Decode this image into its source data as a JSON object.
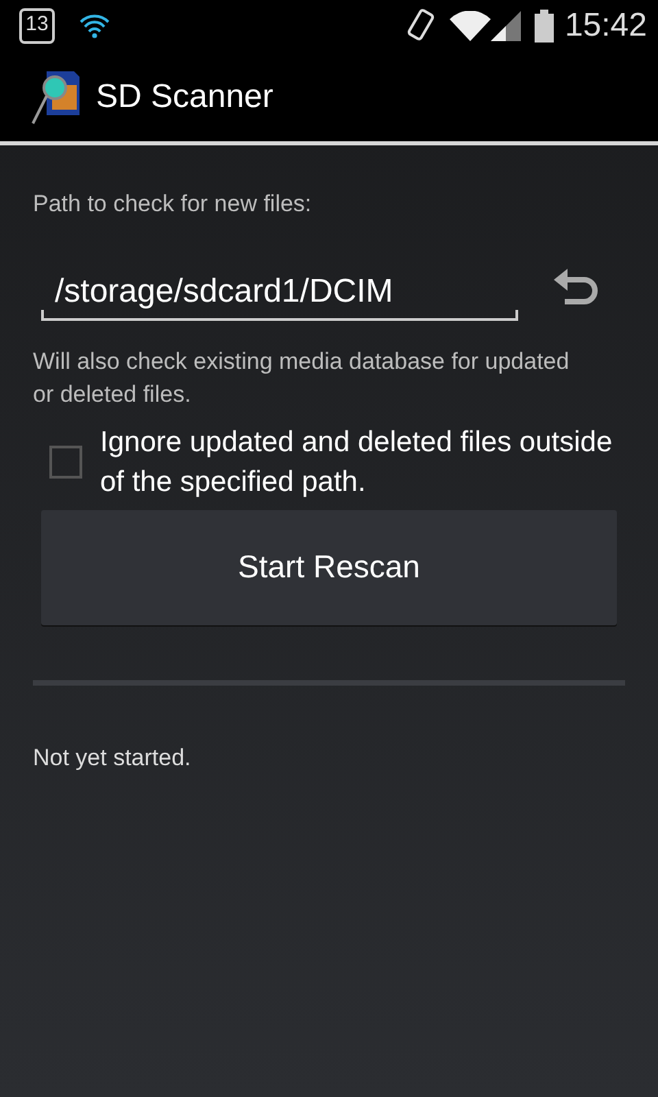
{
  "status_bar": {
    "calendar_day": "13",
    "time": "15:42"
  },
  "action_bar": {
    "title": "SD Scanner"
  },
  "path_label": "Path to check for new files:",
  "path_field": {
    "value": "/storage/sdcard1/DCIM"
  },
  "hint": "Will also check existing media database for updated or deleted files.",
  "ignore_option": {
    "label": "Ignore updated and deleted files outside of the specified path.",
    "checked": false
  },
  "buttons": [
    {
      "label": "Start Rescan"
    }
  ],
  "status_text": "Not yet started."
}
